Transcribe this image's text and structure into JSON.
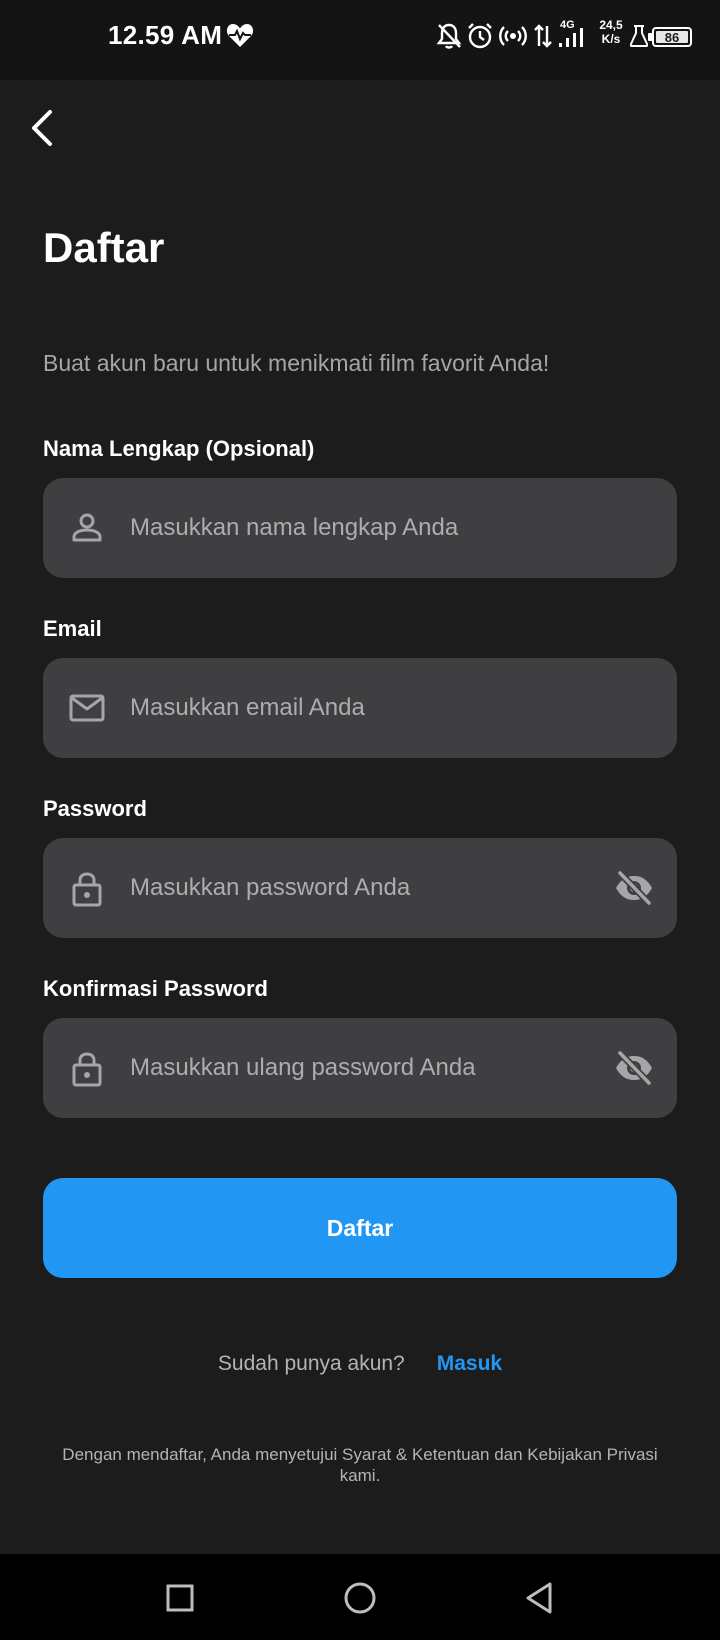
{
  "status_bar": {
    "time": "12.59 AM",
    "network_type": "4G",
    "net_speed_value": "24,5",
    "net_speed_unit": "K/s",
    "battery": "86",
    "icons": [
      "heart-icon",
      "bell-off-icon",
      "alarm-icon",
      "hotspot-icon",
      "data-transfer-icon",
      "signal-icon",
      "flask-icon",
      "battery-icon"
    ]
  },
  "header": {
    "back_icon": "chevron-left-icon",
    "title": "Daftar",
    "subtitle": "Buat akun baru untuk menikmati film favorit Anda!"
  },
  "form": {
    "name": {
      "label": "Nama Lengkap (Opsional)",
      "placeholder": "Masukkan nama lengkap Anda",
      "value": "",
      "icon": "person-icon"
    },
    "email": {
      "label": "Email",
      "placeholder": "Masukkan email Anda",
      "value": "",
      "icon": "mail-icon"
    },
    "password": {
      "label": "Password",
      "placeholder": "Masukkan password Anda",
      "value": "",
      "icon": "lock-icon",
      "toggle_icon": "eye-off-icon"
    },
    "confirm_password": {
      "label": "Konfirmasi Password",
      "placeholder": "Masukkan ulang password Anda",
      "value": "",
      "icon": "lock-icon",
      "toggle_icon": "eye-off-icon"
    },
    "submit_label": "Daftar"
  },
  "login": {
    "prompt": "Sudah punya akun?",
    "link": "Masuk"
  },
  "terms": "Dengan mendaftar, Anda menyetujui Syarat & Ketentuan dan Kebijakan Privasi kami.",
  "colors": {
    "background": "#1c1c1d",
    "field_background": "#3f3f41",
    "accent": "#2196f3",
    "muted_text": "#a6a6a8"
  }
}
